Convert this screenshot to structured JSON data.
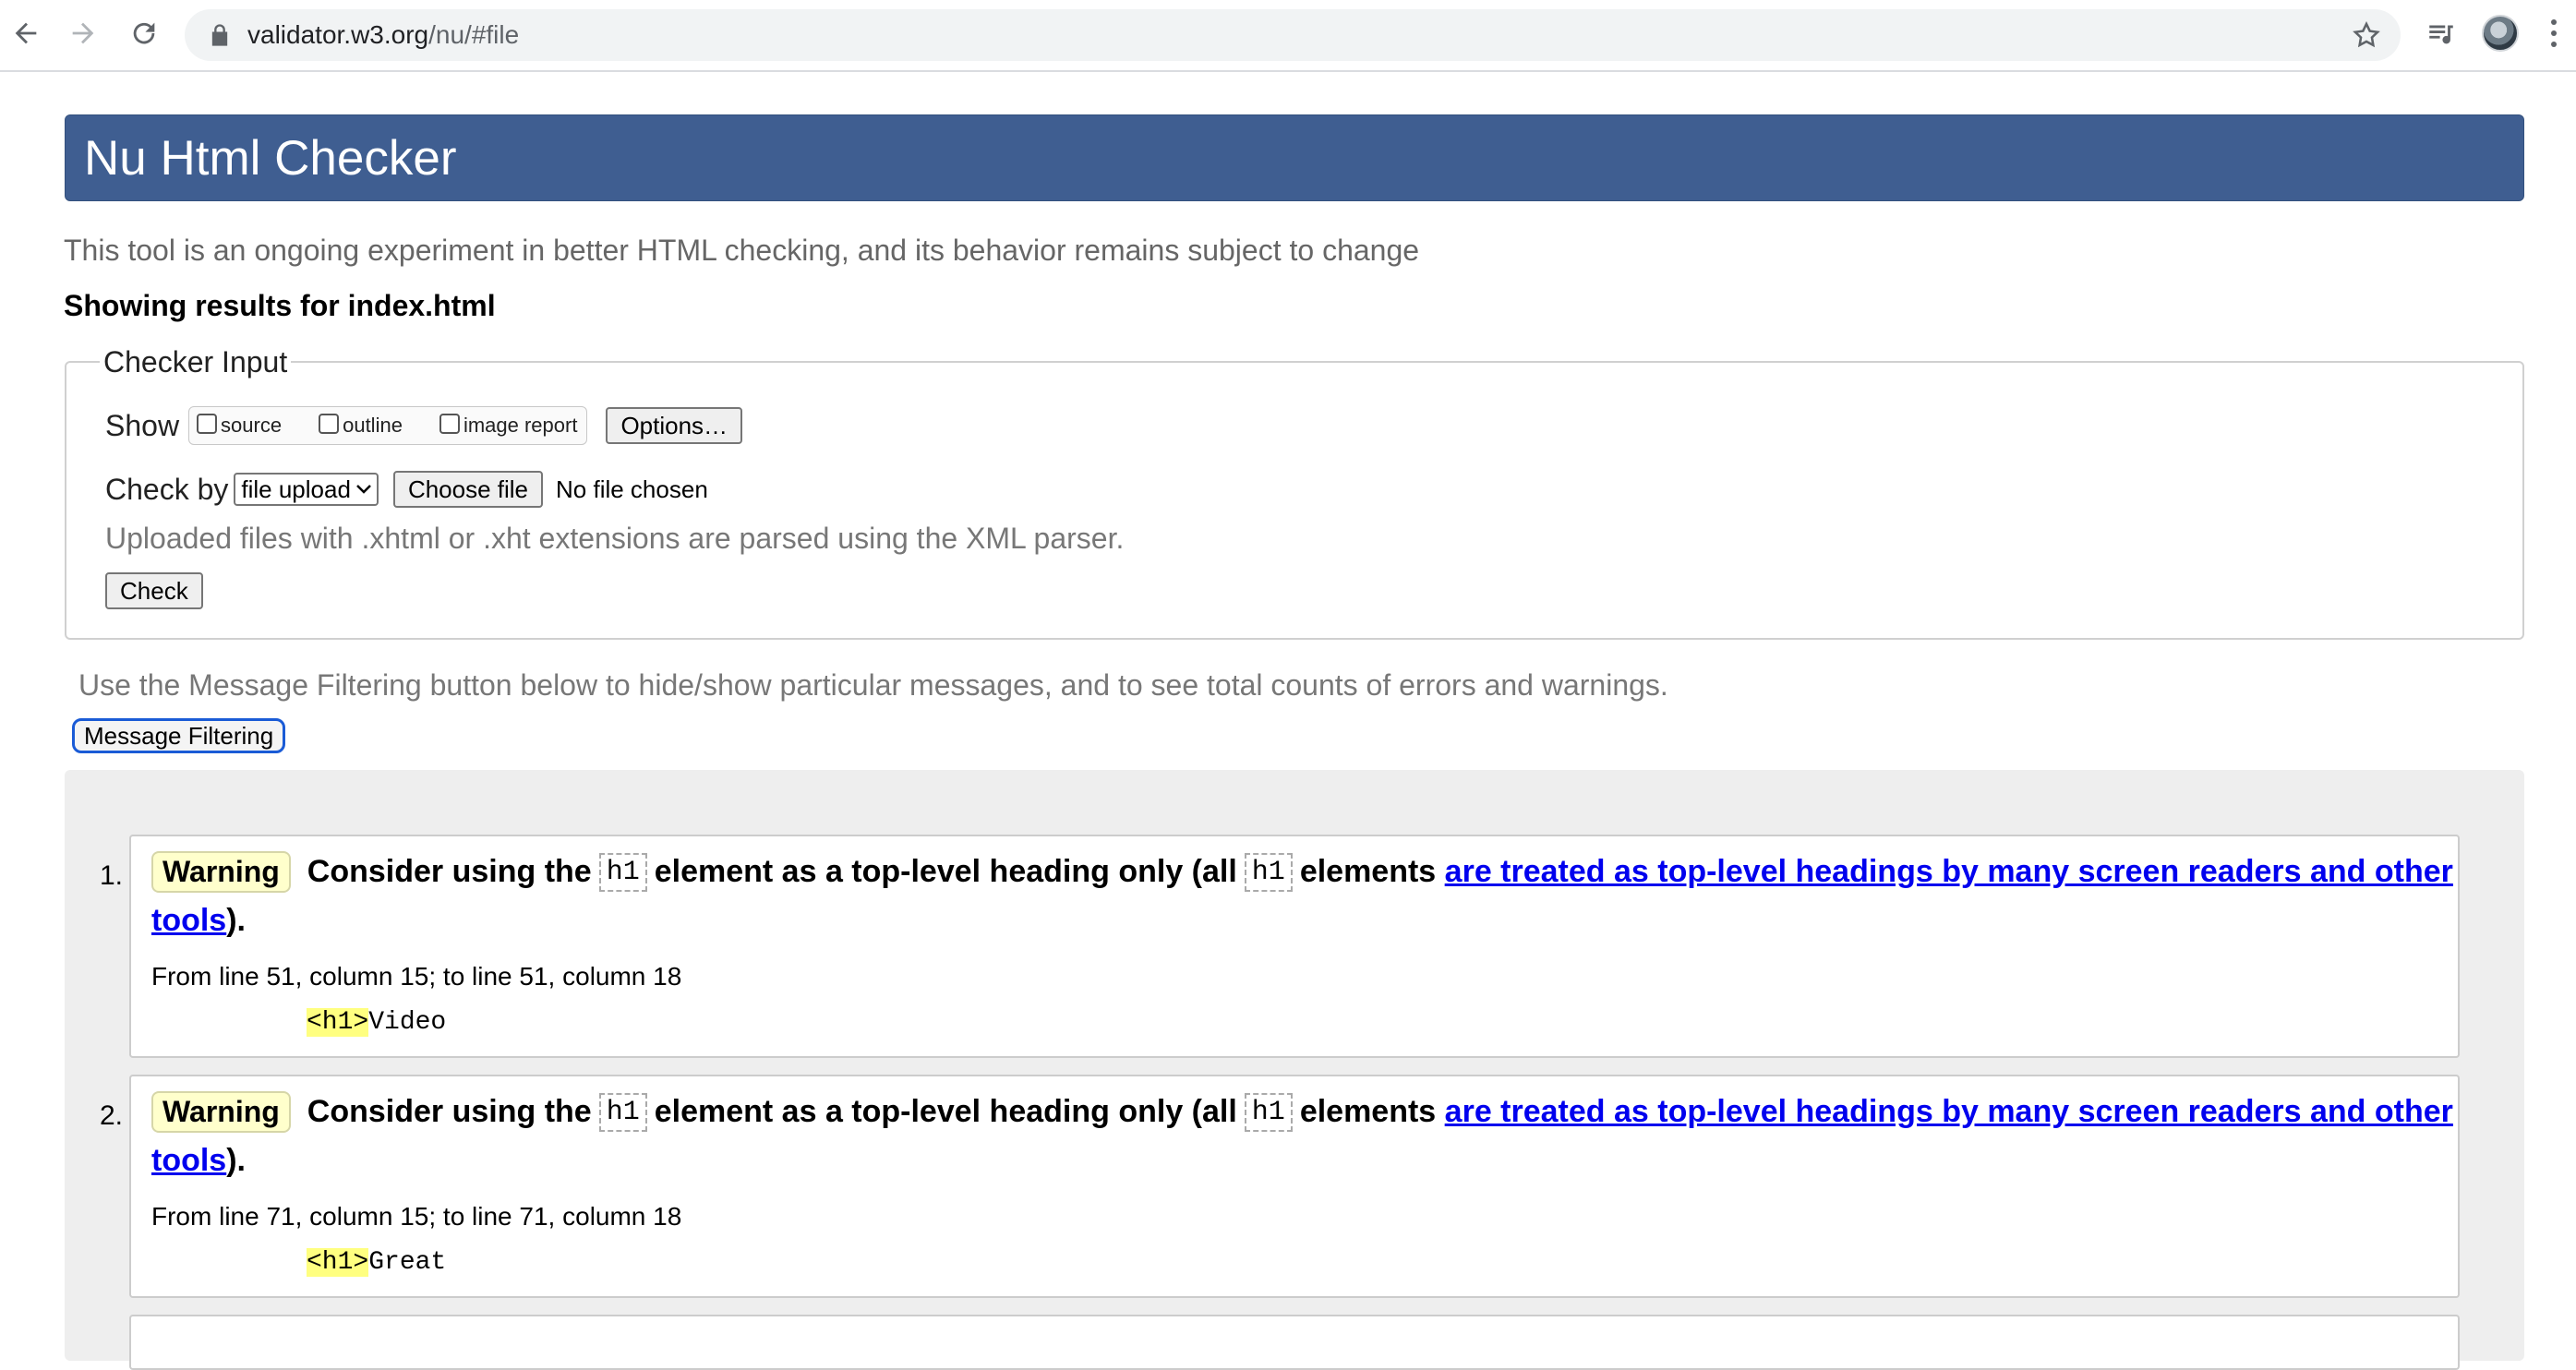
{
  "browser": {
    "url_host": "validator.w3.org",
    "url_path": "/nu/#file",
    "icons": [
      "back-icon",
      "forward-icon",
      "reload-icon",
      "lock-icon",
      "star-icon",
      "playlist-icon",
      "profile-avatar",
      "menu-icon"
    ]
  },
  "page": {
    "title": "Nu Html Checker",
    "intro": "This tool is an ongoing experiment in better HTML checking, and its behavior remains subject to change",
    "showing": "Showing results for index.html"
  },
  "checker_input": {
    "legend": "Checker Input",
    "show_label": "Show",
    "options": [
      "source",
      "outline",
      "image report"
    ],
    "options_button": "Options…",
    "check_by_label": "Check by",
    "check_by_value": "file upload",
    "choose_file": "Choose file",
    "no_file": "No file chosen",
    "note": "Uploaded files with .xhtml or .xht extensions are parsed using the XML parser.",
    "check_button": "Check"
  },
  "filtering": {
    "note": "Use the Message Filtering button below to hide/show particular messages, and to see total counts of errors and warnings.",
    "button": "Message Filtering"
  },
  "messages": [
    {
      "num": "1.",
      "type": "Warning",
      "text_a": "Consider using the",
      "code": "h1",
      "text_b": "element as a top-level heading only (all",
      "text_c": "elements",
      "link_a": "are treated as top-level headings by many screen readers and other",
      "link_b": "tools",
      "tail": ").",
      "location": "From line 51, column 15; to line 51, column 18",
      "extract_tag": "<h1>",
      "extract_text": "Video"
    },
    {
      "num": "2.",
      "type": "Warning",
      "text_a": "Consider using the",
      "code": "h1",
      "text_b": "element as a top-level heading only (all",
      "text_c": "elements",
      "link_a": "are treated as top-level headings by many screen readers and other",
      "link_b": "tools",
      "tail": ").",
      "location": "From line 71, column 15; to line 71, column 18",
      "extract_tag": "<h1>",
      "extract_text": "Great"
    }
  ]
}
